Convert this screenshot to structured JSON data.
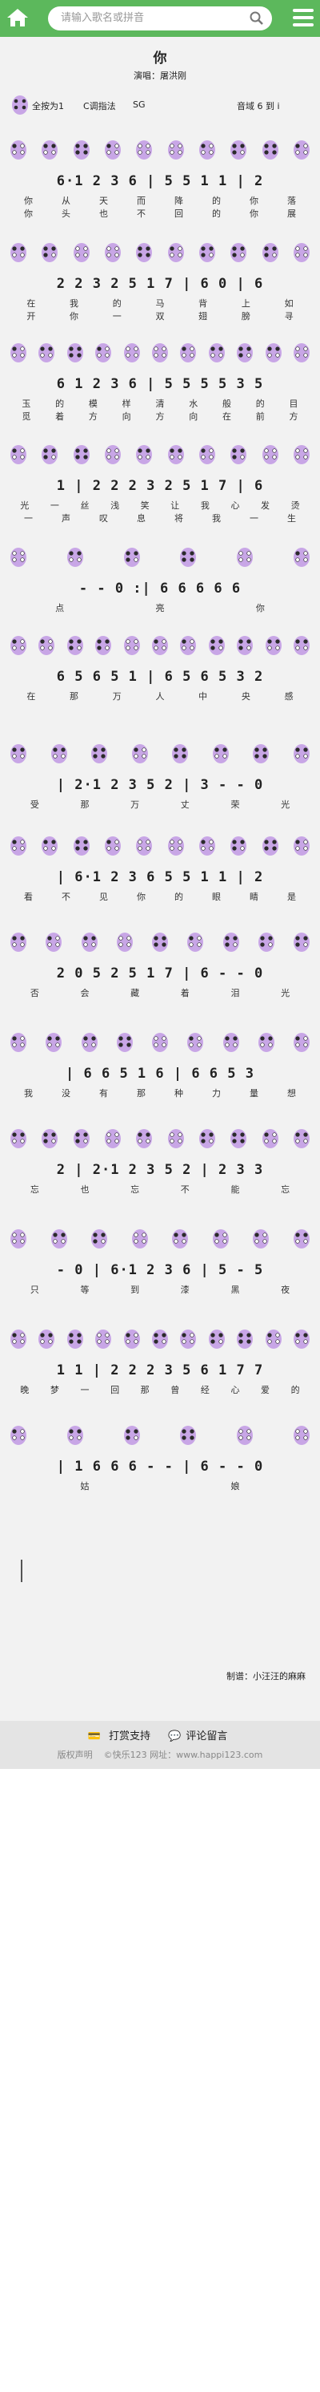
{
  "header": {
    "search_placeholder": "请输入歌名或拼音"
  },
  "song": {
    "title": "你",
    "singer": "演唱：屠洪刚",
    "fingering": "全按为1",
    "key": "C调指法",
    "instrument": "SG",
    "range": "音域 6 到 i"
  },
  "rows": [
    {
      "notes": "6·1  2 3 6 | 5 5 1 1 | 2",
      "lyrics": [
        "你从天而降的你落",
        "你头也不回的你展"
      ]
    },
    {
      "notes": "2 2 3 2 5 1 7 | 6 0 | 6",
      "lyrics": [
        "在我的马背上如",
        "开你一双翅膀寻"
      ]
    },
    {
      "notes": "6 1 2 3 6 | 5 5 5 5 3 5",
      "lyrics": [
        "玉的模样清水般的目",
        "觅着方向方向在前方"
      ]
    },
    {
      "notes": "1 | 2 2 2 3 2 5 1 7 | 6",
      "lyrics": [
        "光一丝浅笑让我心发烫",
        "一声叹息将我一生"
      ]
    },
    {
      "notes": "- - 0 :| 6 6 6 6 6",
      "lyrics": [
        "点亮你"
      ]
    },
    {
      "notes": "6 5 6 5 1 | 6 5 6 5 3 2",
      "lyrics": [
        "在那万人中央感"
      ]
    },
    {
      "notes": "| 2·1 2 3 5 2 | 3 - - 0",
      "lyrics": [
        "受那万丈荣光"
      ]
    },
    {
      "notes": "| 6·1 2 3 6 5 5 1 1 | 2",
      "lyrics": [
        "看不见你的眼睛是"
      ]
    },
    {
      "notes": "2 0 5 2 5 1 7 | 6 - - 0",
      "lyrics": [
        "否会藏着泪光"
      ]
    },
    {
      "notes": "| 6 6 5 1 6 | 6 6 5 3",
      "lyrics": [
        "我没有那种力量想"
      ]
    },
    {
      "notes": "2 | 2·1 2 3 5 2 | 2 3 3",
      "lyrics": [
        "忘也忘不能忘"
      ]
    },
    {
      "notes": "- 0 | 6·1 2 3 6 | 5 - 5",
      "lyrics": [
        "只等到漆黑夜"
      ]
    },
    {
      "notes": "1 1 | 2 2 2 3 5 6 1 7 7",
      "lyrics": [
        "晚梦一回那曾经心爱的"
      ]
    },
    {
      "notes": "| 1 6 6 6 - - | 6 - - 0",
      "lyrics": [
        "姑娘"
      ]
    }
  ],
  "credit": "制谱：小汪汪的麻麻",
  "footer": {
    "donate": "打赏支持",
    "comment": "评论留言",
    "copyright": "版权声明",
    "brand": "©快乐123",
    "site": "网址：www.happi123.com"
  },
  "colors": {
    "header": "#5cb85c",
    "flute": "#c8a6e6",
    "hole": "#2b2b2b"
  }
}
